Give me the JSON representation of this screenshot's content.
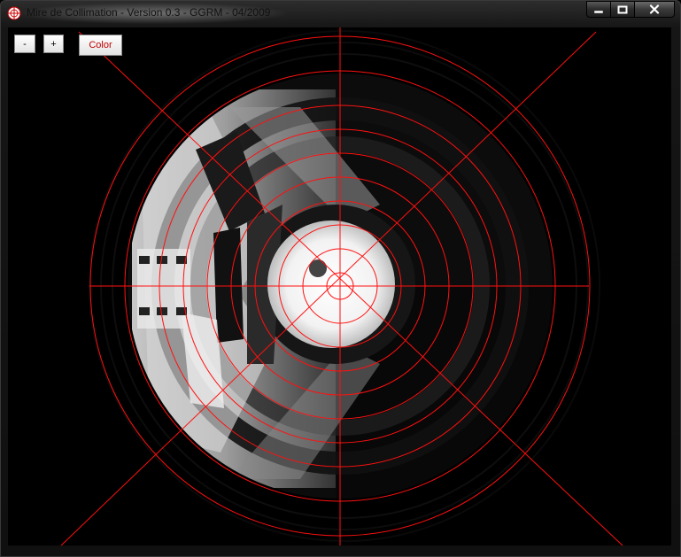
{
  "window": {
    "title": "Mire de Collimation - Version 0.3 - GGRM - 04/2009",
    "minimize_glyph": "━",
    "maximize_glyph": "□",
    "close_glyph": "✕"
  },
  "toolbar": {
    "minus_label": "-",
    "plus_label": "+",
    "color_label": "Color"
  },
  "reticle": {
    "color": "#ff1010",
    "circle_count": 10
  },
  "icons": {
    "app": "crosshair-target-icon"
  }
}
